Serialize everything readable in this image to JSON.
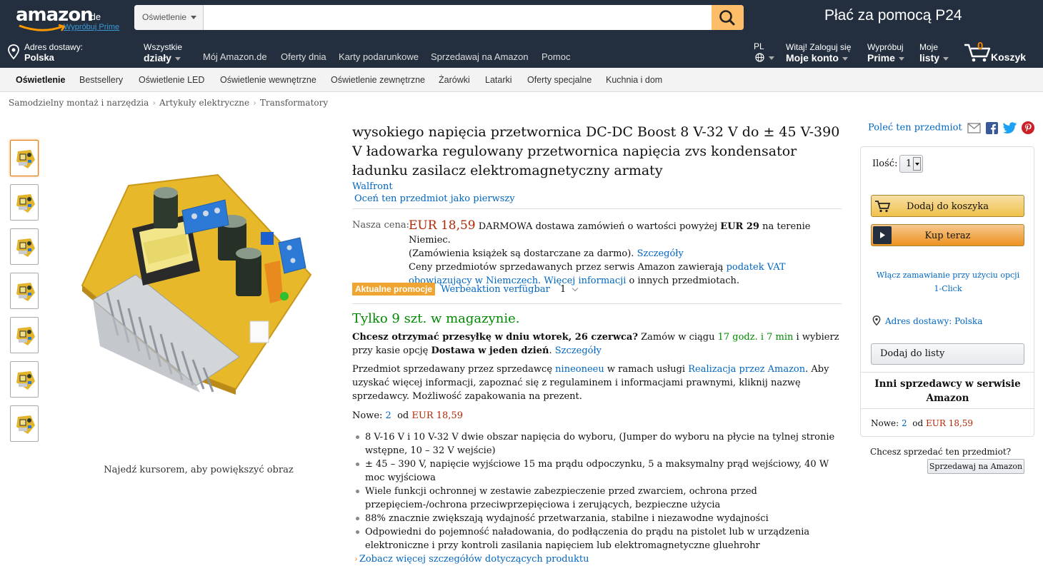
{
  "colors": {
    "nav_bg": "#232f3e",
    "price": "#b12704",
    "link": "#0066c0",
    "in_stock": "#008a00",
    "cart_button": "#f0c14b",
    "buy_button": "#ed9220",
    "promo_badge": "#f0a431",
    "search_button": "#febd69"
  },
  "header": {
    "logo_text": "amazon",
    "logo_tld": ".de",
    "logo_prime": "Wypróbuj Prime",
    "search": {
      "category": "Oświetlenie",
      "placeholder": "",
      "value": "",
      "icon": "search-icon"
    },
    "promo": "Płać za pomocą P24",
    "delivery": {
      "line1": "Adres dostawy:",
      "line2": "Polska",
      "icon": "location-pin-icon"
    },
    "departments": {
      "line1": "Wszystkie",
      "line2": "działy"
    },
    "links": [
      "Mój Amazon.de",
      "Oferty dnia",
      "Karty podarunkowe",
      "Sprzedawaj na Amazon",
      "Pomoc"
    ],
    "language": {
      "line1": "PL",
      "icon": "globe-icon"
    },
    "account": {
      "line1": "Witaj! Zaloguj się",
      "line2": "Moje konto"
    },
    "prime": {
      "line1": "Wypróbuj",
      "line2": "Prime"
    },
    "lists": {
      "line1": "Moje",
      "line2": "listy"
    },
    "cart": {
      "count": "0",
      "label": "Koszyk",
      "icon": "cart-icon"
    }
  },
  "subnav": [
    "Oświetlenie",
    "Bestsellery",
    "Oświetlenie LED",
    "Oświetlenie wewnętrzne",
    "Oświetlenie zewnętrzne",
    "Żarówki",
    "Latarki",
    "Oferty specjalne",
    "Kuchnia i dom"
  ],
  "breadcrumb": [
    "Samodzielny montaż i narzędzia",
    "Artykuły elektryczne",
    "Transformatory"
  ],
  "gallery": {
    "thumb_count": 7,
    "selected": 0,
    "hover_hint": "Najedź kursorem, aby powiększyć obraz"
  },
  "product": {
    "title": "wysokiego napięcia przetwornica DC-DC Boost 8 V-32 V do ± 45 V-390 V ładowarka regulowany przetwornica napięcia zvs kondensator ładunku zasilacz elektromagnetyczny armaty",
    "brand": "Walfront",
    "review_link": "Oceń ten przedmiot jako pierwszy",
    "price_label": "Nasza cena:",
    "price": "EUR 18,59",
    "shipping": {
      "free": "DARMOWA",
      "text1": "dostawa zamówień o wartości powyżej",
      "threshold": "EUR 29",
      "text2": "na terenie Niemiec.",
      "text3": "(Zamówienia książek są dostarczane za darmo).",
      "details_link": "Szczegóły"
    },
    "vat": {
      "text1": "Ceny przedmiotów sprzedawanych przez serwis Amazon zawierają",
      "vat_link": "podatek VAT obowiązujący w Niemczech.",
      "more_link": "Więcej informacji",
      "text2": "o innych przedmiotach."
    },
    "promo": {
      "badge": "Aktualne promocje",
      "text": "Werbeaktion verfügbar",
      "count": "1"
    },
    "stock": "Tylko 9 szt. w magazynie.",
    "delivery": {
      "bold": "Chcesz otrzymać przesyłkę w dniu wtorek, 26 czerwca?",
      "text1": "Zamów w ciągu",
      "countdown": "17 godz. i 7 min",
      "text2": "i wybierz przy kasie opcję",
      "option": "Dostawa w jeden dzień",
      "details_link": "Szczegóły"
    },
    "seller": {
      "text1": "Przedmiot sprzedawany przez sprzedawcę",
      "seller_link": "nineoneeu",
      "text2": "w ramach usługi",
      "fba_link": "Realizacja przez Amazon",
      "text3": ". Aby uzyskać więcej informacji, zapoznać się z regulaminem i informacjami prawnymi, kliknij nazwę sprzedawcy. Możliwość zapakowania na prezent."
    },
    "new_offers": {
      "label": "Nowe:",
      "count": "2",
      "from": "od",
      "price": "EUR 18,59"
    },
    "bullets": [
      "8 V-16 V i 10 V-32 V dwie obszar napięcia do wyboru, (Jumper do wyboru na płycie na tylnej stronie wstępne, 10 – 32 V wejście)",
      "± 45 – 390 V, napięcie wyjściowe 15 ma prądu odpoczynku, 5 a maksymalny prąd wejściowy, 40 W moc wyjściowa",
      "Wiele funkcji ochronnej w zestawie zabezpieczenie przed zwarciem, ochrona przed przepięciem-/ochrona przeciwprzepięciowa i zerujących, bezpieczne użycia",
      "88% znacznie zwiększają wydajność przetwarzania, stabilne i niezawodne wydajności",
      "Odpowiedni do pojemność naładowania, do podłączenia do prądu na pistolet lub w urządzenia elektroniczne i przy kontroli zasilania napięciem lub elektromagnetyczne gluehrohr"
    ],
    "more_details_link": "Zobacz więcej szczegółów dotyczących produktu"
  },
  "share": {
    "label": "Poleć ten przedmiot",
    "icons": [
      "email-icon",
      "facebook-icon",
      "twitter-icon",
      "pinterest-icon"
    ]
  },
  "buybox": {
    "qty_label": "Ilość:",
    "qty_value": "1",
    "add_to_cart": "Dodaj do koszyka",
    "buy_now": "Kup teraz",
    "one_click": "Włącz zamawianie przy użyciu opcji 1-Click",
    "ship_to": "Adres dostawy: Polska",
    "add_to_list": "Dodaj do listy",
    "other_sellers_title": "Inni sprzedawcy w serwisie Amazon",
    "other_offer": {
      "label": "Nowe:",
      "count": "2",
      "from": "od",
      "price": "EUR 18,59"
    }
  },
  "sell": {
    "question": "Chcesz sprzedać ten przedmiot?",
    "button": "Sprzedawaj na Amazon"
  }
}
